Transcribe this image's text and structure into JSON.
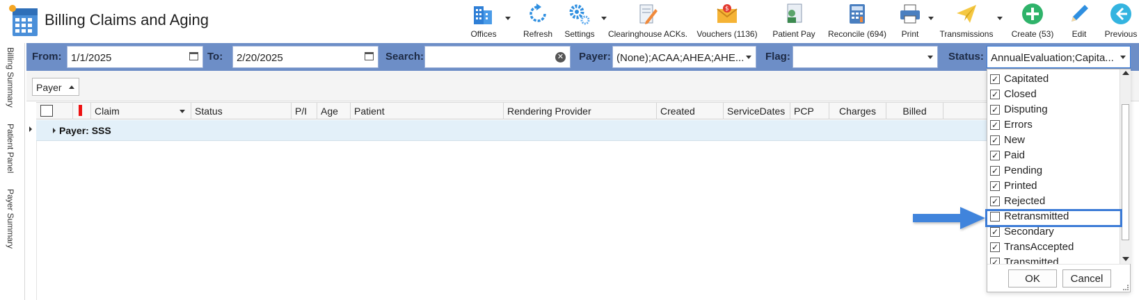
{
  "app": {
    "title": "Billing Claims and Aging",
    "accent": "#6d8ec7"
  },
  "toolbar": [
    {
      "label": "Offices",
      "icon": "offices-icon",
      "dropdown": true
    },
    {
      "label": "Refresh",
      "icon": "refresh-icon",
      "dropdown": false
    },
    {
      "label": "Settings",
      "icon": "settings-gear-icon",
      "dropdown": true
    },
    {
      "label": "Clearinghouse ACKs.",
      "icon": "clearinghouse-icon",
      "dropdown": false
    },
    {
      "label": "Vouchers (1136)",
      "icon": "vouchers-envelope-icon",
      "dropdown": false
    },
    {
      "label": "Patient Pay",
      "icon": "patient-pay-icon",
      "dropdown": false
    },
    {
      "label": "Reconcile (694)",
      "icon": "calculator-icon",
      "dropdown": false
    },
    {
      "label": "Print",
      "icon": "printer-icon",
      "dropdown": true
    },
    {
      "label": "Transmissions",
      "icon": "paper-plane-icon",
      "dropdown": true
    },
    {
      "label": "Create (53)",
      "icon": "plus-circle-icon",
      "dropdown": false
    },
    {
      "label": "Edit",
      "icon": "pencil-icon",
      "dropdown": false
    },
    {
      "label": "Previous",
      "icon": "back-arrow-icon",
      "dropdown": false
    }
  ],
  "sidetabs": [
    "Billing Summary",
    "Patient Panel",
    "Payer Summary"
  ],
  "filters": {
    "from_label": "From:",
    "from_value": "1/1/2025",
    "to_label": "To:",
    "to_value": "2/20/2025",
    "search_label": "Search:",
    "search_value": "",
    "payer_label": "Payer:",
    "payer_value": "(None);ACAA;AHEA;AHE...",
    "flag_label": "Flag:",
    "flag_value": "",
    "status_label": "Status:",
    "status_value": "AnnualEvaluation;Capita..."
  },
  "group": {
    "chip_label": "Payer",
    "row_label": "Payer: SSS"
  },
  "columns": [
    "Claim",
    "Status",
    "P/I",
    "Age",
    "Patient",
    "Rendering Provider",
    "Created",
    "ServiceDates",
    "PCP",
    "Charges",
    "Billed"
  ],
  "status_options": [
    {
      "label": "Capitated",
      "checked": true
    },
    {
      "label": "Closed",
      "checked": true
    },
    {
      "label": "Disputing",
      "checked": true
    },
    {
      "label": "Errors",
      "checked": true
    },
    {
      "label": "New",
      "checked": true
    },
    {
      "label": "Paid",
      "checked": true
    },
    {
      "label": "Pending",
      "checked": true
    },
    {
      "label": "Printed",
      "checked": true
    },
    {
      "label": "Rejected",
      "checked": true
    },
    {
      "label": "Retransmitted",
      "checked": false
    },
    {
      "label": "Secondary",
      "checked": true
    },
    {
      "label": "TransAccepted",
      "checked": true
    },
    {
      "label": "Transmitted",
      "checked": true
    }
  ],
  "dropdown_buttons": {
    "ok": "OK",
    "cancel": "Cancel"
  }
}
